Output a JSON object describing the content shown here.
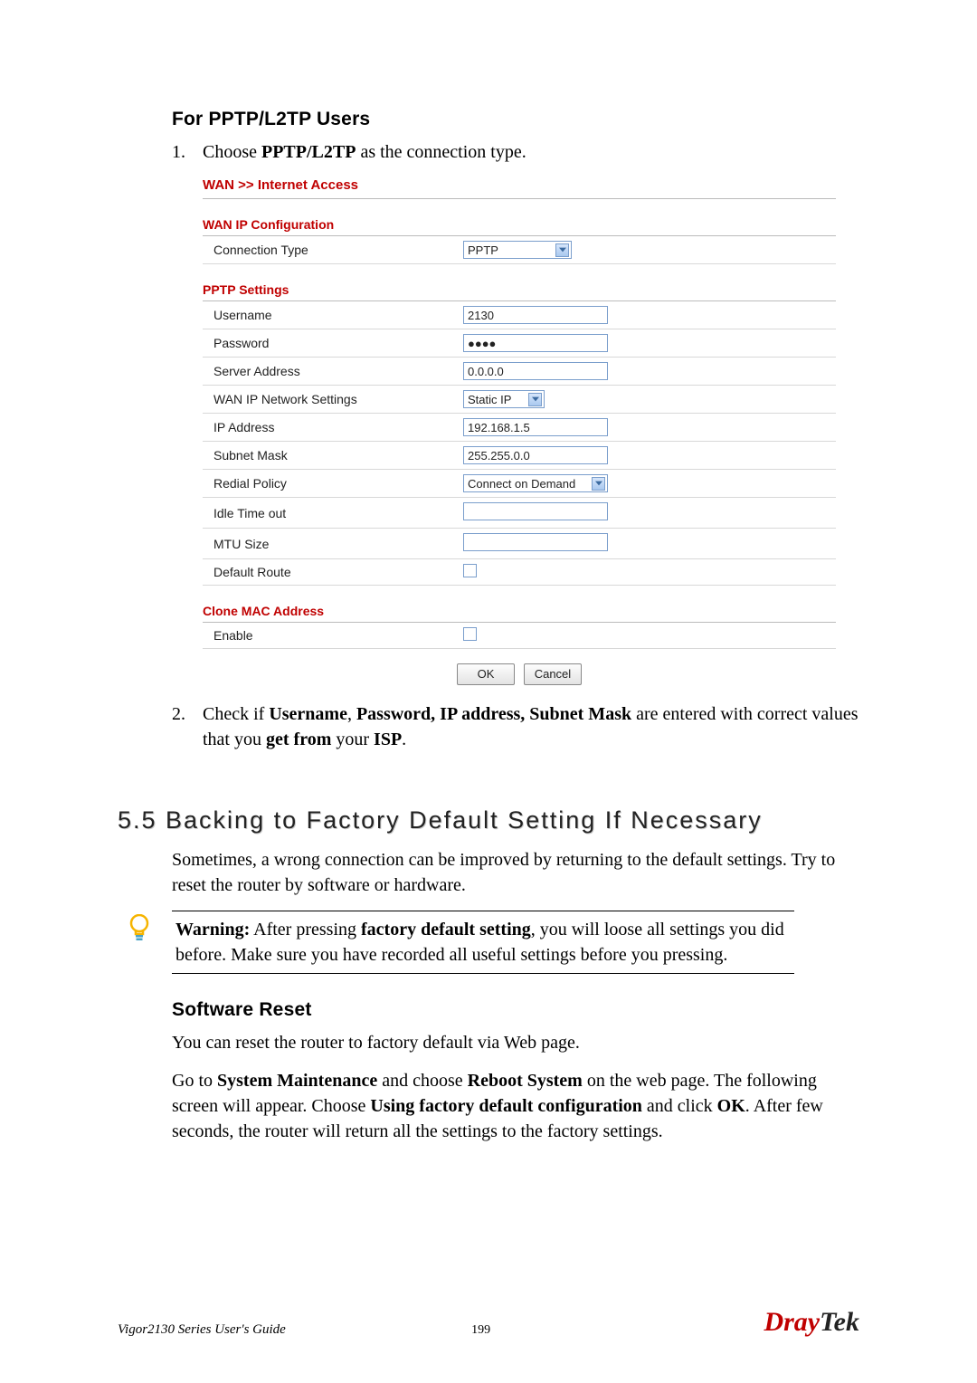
{
  "heading_pptp": "For PPTP/L2TP Users",
  "step1": {
    "num": "1.",
    "pre": "Choose ",
    "bold": "PPTP/L2TP",
    "post": " as the connection type."
  },
  "step2": {
    "num": "2.",
    "p1": "Check if ",
    "b1": "Username",
    "p2": ", ",
    "b2": "Password, IP address, Subnet Mask",
    "p3": " are entered with correct values that you ",
    "b3": "get from",
    "p4": " your ",
    "b4": "ISP",
    "p5": "."
  },
  "shot": {
    "breadcrumb": "WAN >> Internet Access",
    "sec1": "WAN IP Configuration",
    "conn_type_label": "Connection Type",
    "conn_type_value": "PPTP",
    "sec2": "PPTP Settings",
    "rows": {
      "username_label": "Username",
      "username_value": "2130",
      "password_label": "Password",
      "password_value": "●●●●",
      "server_label": "Server Address",
      "server_value": "0.0.0.0",
      "wanip_label": "WAN IP Network Settings",
      "wanip_value": "Static IP",
      "ip_label": "IP Address",
      "ip_value": "192.168.1.5",
      "subnet_label": "Subnet Mask",
      "subnet_value": "255.255.0.0",
      "redial_label": "Redial Policy",
      "redial_value": "Connect on Demand",
      "idle_label": "Idle Time out",
      "idle_value": "",
      "mtu_label": "MTU Size",
      "mtu_value": "",
      "defroute_label": "Default Route"
    },
    "sec3": "Clone MAC Address",
    "enable_label": "Enable",
    "ok": "OK",
    "cancel": "Cancel"
  },
  "sec55": {
    "title": "5.5 Backing to Factory Default Setting If Necessary",
    "intro": "Sometimes, a wrong connection can be improved by returning to the default settings. Try to reset the router by software or hardware.",
    "warn_b1": "Warning:",
    "warn_p1": " After pressing ",
    "warn_b2": "factory default setting",
    "warn_p2": ", you will loose all settings you did before. Make sure you have recorded all useful settings before you pressing.",
    "sw_reset": "Software Reset",
    "sw_para": "You can reset the router to factory default via Web page.",
    "goto_p1": "Go to ",
    "goto_b1": "System Maintenance",
    "goto_p2": " and choose ",
    "goto_b2": "Reboot System",
    "goto_p3": " on the web page. The following screen will appear. Choose ",
    "goto_b3": "Using factory default configuration",
    "goto_p4": " and click ",
    "goto_b4": "OK",
    "goto_p5": ". After few seconds, the router will return all the settings to the factory settings."
  },
  "footer": {
    "guide": "Vigor2130 Series User's Guide",
    "page": "199",
    "logo_d": "Dray",
    "logo_t": "Tek"
  }
}
